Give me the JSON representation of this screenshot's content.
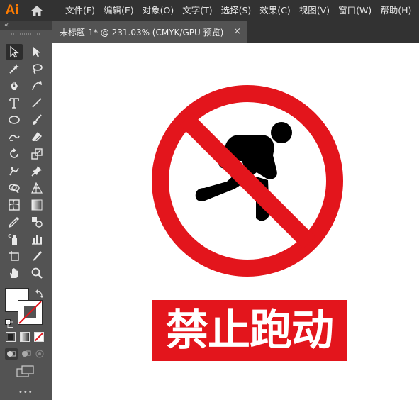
{
  "app": {
    "logo": "Ai"
  },
  "menu": [
    {
      "label": "文件(F)"
    },
    {
      "label": "编辑(E)"
    },
    {
      "label": "对象(O)"
    },
    {
      "label": "文字(T)"
    },
    {
      "label": "选择(S)"
    },
    {
      "label": "效果(C)"
    },
    {
      "label": "视图(V)"
    },
    {
      "label": "窗口(W)"
    },
    {
      "label": "帮助(H)"
    }
  ],
  "panel": {
    "collapse_label": "«",
    "more_label": "•••"
  },
  "document": {
    "tab_title": "未标题-1* @ 231.03% (CMYK/GPU 预览)",
    "close_label": "×"
  },
  "artwork": {
    "sign_text": "禁止跑动",
    "colors": {
      "red": "#e3151c",
      "figure": "#000000",
      "background": "#ffffff"
    }
  }
}
